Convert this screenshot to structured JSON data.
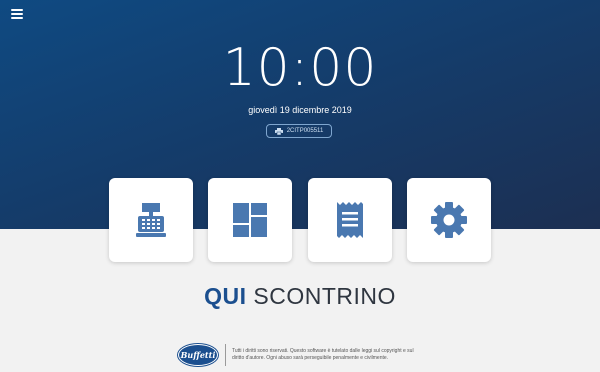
{
  "header": {
    "menu_icon": "hamburger-menu-icon"
  },
  "clock": {
    "time": "10:00",
    "date": "giovedì 19 dicembre 2019"
  },
  "printer": {
    "icon": "printer-icon",
    "id": "2CITP005511"
  },
  "tiles": [
    {
      "icon": "cash-register-icon"
    },
    {
      "icon": "dashboard-grid-icon"
    },
    {
      "icon": "receipt-icon"
    },
    {
      "icon": "gear-icon"
    }
  ],
  "brand": {
    "word1": "QUI",
    "word2": "SCONTRINO"
  },
  "footer": {
    "logo_text": "Buffetti",
    "line1": "Tutti i diritti sono riservati. Questo software è tutelato dalle leggi sul copyright e sul",
    "line2": "diritto d'autore. Ogni abuso sarà perseguibile penalmente e civilmente."
  },
  "colors": {
    "hero_top": "#0f4a82",
    "hero_bottom": "#1c2f52",
    "accent": "#4a78b0",
    "brand_blue": "#1b4f8f",
    "background": "#f2f2f2"
  }
}
